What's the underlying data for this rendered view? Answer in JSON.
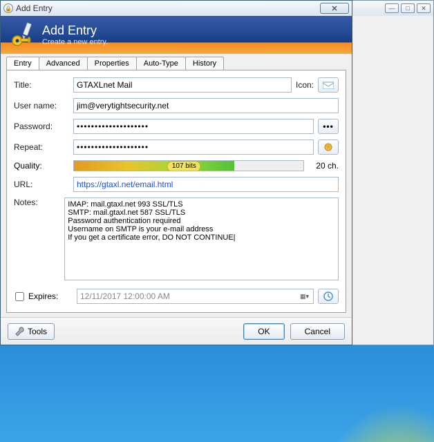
{
  "window": {
    "title": "Add Entry"
  },
  "banner": {
    "title": "Add Entry",
    "subtitle": "Create a new entry."
  },
  "tabs": {
    "t0": "Entry",
    "t1": "Advanced",
    "t2": "Properties",
    "t3": "Auto-Type",
    "t4": "History"
  },
  "labels": {
    "title": "Title:",
    "icon": "Icon:",
    "username": "User name:",
    "password": "Password:",
    "repeat": "Repeat:",
    "quality": "Quality:",
    "url": "URL:",
    "notes": "Notes:",
    "expires": "Expires:"
  },
  "fields": {
    "title": "GTAXLnet Mail",
    "username": "jim@verytightsecurity.net",
    "password": "••••••••••••••••••••",
    "repeat": "••••••••••••••••••••",
    "url": "https://gtaxl.net/email.html",
    "notes": "IMAP: mail.gtaxl.net 993 SSL/TLS\nSMTP: mail.gtaxl.net 587 SSL/TLS\nPassword authentication required\nUsername on SMTP is your e-mail address\nIf you get a certificate error, DO NOT CONTINUE|",
    "expires_date": "12/11/2017 12:00:00 AM",
    "expires_checked": false
  },
  "quality": {
    "bits": "107 bits",
    "chars": "20 ch."
  },
  "footer": {
    "tools": "Tools",
    "ok": "OK",
    "cancel": "Cancel"
  }
}
